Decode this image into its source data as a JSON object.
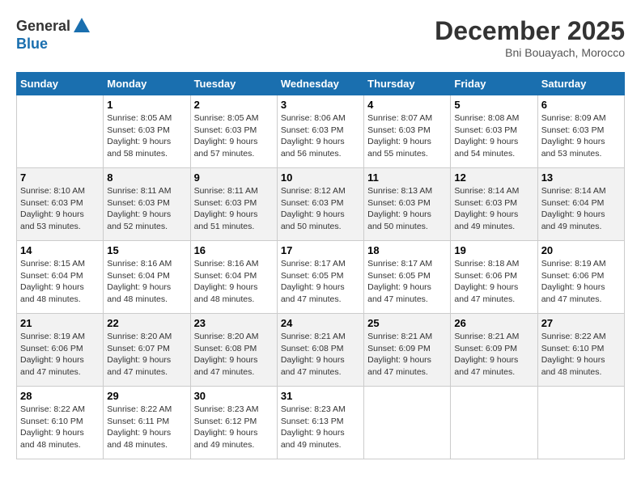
{
  "header": {
    "logo_general": "General",
    "logo_blue": "Blue",
    "month_year": "December 2025",
    "location": "Bni Bouayach, Morocco"
  },
  "days_of_week": [
    "Sunday",
    "Monday",
    "Tuesday",
    "Wednesday",
    "Thursday",
    "Friday",
    "Saturday"
  ],
  "weeks": [
    [
      {
        "day": "",
        "sunrise": "",
        "sunset": "",
        "daylight": ""
      },
      {
        "day": "1",
        "sunrise": "Sunrise: 8:05 AM",
        "sunset": "Sunset: 6:03 PM",
        "daylight": "Daylight: 9 hours and 58 minutes."
      },
      {
        "day": "2",
        "sunrise": "Sunrise: 8:05 AM",
        "sunset": "Sunset: 6:03 PM",
        "daylight": "Daylight: 9 hours and 57 minutes."
      },
      {
        "day": "3",
        "sunrise": "Sunrise: 8:06 AM",
        "sunset": "Sunset: 6:03 PM",
        "daylight": "Daylight: 9 hours and 56 minutes."
      },
      {
        "day": "4",
        "sunrise": "Sunrise: 8:07 AM",
        "sunset": "Sunset: 6:03 PM",
        "daylight": "Daylight: 9 hours and 55 minutes."
      },
      {
        "day": "5",
        "sunrise": "Sunrise: 8:08 AM",
        "sunset": "Sunset: 6:03 PM",
        "daylight": "Daylight: 9 hours and 54 minutes."
      },
      {
        "day": "6",
        "sunrise": "Sunrise: 8:09 AM",
        "sunset": "Sunset: 6:03 PM",
        "daylight": "Daylight: 9 hours and 53 minutes."
      }
    ],
    [
      {
        "day": "7",
        "sunrise": "Sunrise: 8:10 AM",
        "sunset": "Sunset: 6:03 PM",
        "daylight": "Daylight: 9 hours and 53 minutes."
      },
      {
        "day": "8",
        "sunrise": "Sunrise: 8:11 AM",
        "sunset": "Sunset: 6:03 PM",
        "daylight": "Daylight: 9 hours and 52 minutes."
      },
      {
        "day": "9",
        "sunrise": "Sunrise: 8:11 AM",
        "sunset": "Sunset: 6:03 PM",
        "daylight": "Daylight: 9 hours and 51 minutes."
      },
      {
        "day": "10",
        "sunrise": "Sunrise: 8:12 AM",
        "sunset": "Sunset: 6:03 PM",
        "daylight": "Daylight: 9 hours and 50 minutes."
      },
      {
        "day": "11",
        "sunrise": "Sunrise: 8:13 AM",
        "sunset": "Sunset: 6:03 PM",
        "daylight": "Daylight: 9 hours and 50 minutes."
      },
      {
        "day": "12",
        "sunrise": "Sunrise: 8:14 AM",
        "sunset": "Sunset: 6:03 PM",
        "daylight": "Daylight: 9 hours and 49 minutes."
      },
      {
        "day": "13",
        "sunrise": "Sunrise: 8:14 AM",
        "sunset": "Sunset: 6:04 PM",
        "daylight": "Daylight: 9 hours and 49 minutes."
      }
    ],
    [
      {
        "day": "14",
        "sunrise": "Sunrise: 8:15 AM",
        "sunset": "Sunset: 6:04 PM",
        "daylight": "Daylight: 9 hours and 48 minutes."
      },
      {
        "day": "15",
        "sunrise": "Sunrise: 8:16 AM",
        "sunset": "Sunset: 6:04 PM",
        "daylight": "Daylight: 9 hours and 48 minutes."
      },
      {
        "day": "16",
        "sunrise": "Sunrise: 8:16 AM",
        "sunset": "Sunset: 6:04 PM",
        "daylight": "Daylight: 9 hours and 48 minutes."
      },
      {
        "day": "17",
        "sunrise": "Sunrise: 8:17 AM",
        "sunset": "Sunset: 6:05 PM",
        "daylight": "Daylight: 9 hours and 47 minutes."
      },
      {
        "day": "18",
        "sunrise": "Sunrise: 8:17 AM",
        "sunset": "Sunset: 6:05 PM",
        "daylight": "Daylight: 9 hours and 47 minutes."
      },
      {
        "day": "19",
        "sunrise": "Sunrise: 8:18 AM",
        "sunset": "Sunset: 6:06 PM",
        "daylight": "Daylight: 9 hours and 47 minutes."
      },
      {
        "day": "20",
        "sunrise": "Sunrise: 8:19 AM",
        "sunset": "Sunset: 6:06 PM",
        "daylight": "Daylight: 9 hours and 47 minutes."
      }
    ],
    [
      {
        "day": "21",
        "sunrise": "Sunrise: 8:19 AM",
        "sunset": "Sunset: 6:06 PM",
        "daylight": "Daylight: 9 hours and 47 minutes."
      },
      {
        "day": "22",
        "sunrise": "Sunrise: 8:20 AM",
        "sunset": "Sunset: 6:07 PM",
        "daylight": "Daylight: 9 hours and 47 minutes."
      },
      {
        "day": "23",
        "sunrise": "Sunrise: 8:20 AM",
        "sunset": "Sunset: 6:08 PM",
        "daylight": "Daylight: 9 hours and 47 minutes."
      },
      {
        "day": "24",
        "sunrise": "Sunrise: 8:21 AM",
        "sunset": "Sunset: 6:08 PM",
        "daylight": "Daylight: 9 hours and 47 minutes."
      },
      {
        "day": "25",
        "sunrise": "Sunrise: 8:21 AM",
        "sunset": "Sunset: 6:09 PM",
        "daylight": "Daylight: 9 hours and 47 minutes."
      },
      {
        "day": "26",
        "sunrise": "Sunrise: 8:21 AM",
        "sunset": "Sunset: 6:09 PM",
        "daylight": "Daylight: 9 hours and 47 minutes."
      },
      {
        "day": "27",
        "sunrise": "Sunrise: 8:22 AM",
        "sunset": "Sunset: 6:10 PM",
        "daylight": "Daylight: 9 hours and 48 minutes."
      }
    ],
    [
      {
        "day": "28",
        "sunrise": "Sunrise: 8:22 AM",
        "sunset": "Sunset: 6:10 PM",
        "daylight": "Daylight: 9 hours and 48 minutes."
      },
      {
        "day": "29",
        "sunrise": "Sunrise: 8:22 AM",
        "sunset": "Sunset: 6:11 PM",
        "daylight": "Daylight: 9 hours and 48 minutes."
      },
      {
        "day": "30",
        "sunrise": "Sunrise: 8:23 AM",
        "sunset": "Sunset: 6:12 PM",
        "daylight": "Daylight: 9 hours and 49 minutes."
      },
      {
        "day": "31",
        "sunrise": "Sunrise: 8:23 AM",
        "sunset": "Sunset: 6:13 PM",
        "daylight": "Daylight: 9 hours and 49 minutes."
      },
      {
        "day": "",
        "sunrise": "",
        "sunset": "",
        "daylight": ""
      },
      {
        "day": "",
        "sunrise": "",
        "sunset": "",
        "daylight": ""
      },
      {
        "day": "",
        "sunrise": "",
        "sunset": "",
        "daylight": ""
      }
    ]
  ]
}
